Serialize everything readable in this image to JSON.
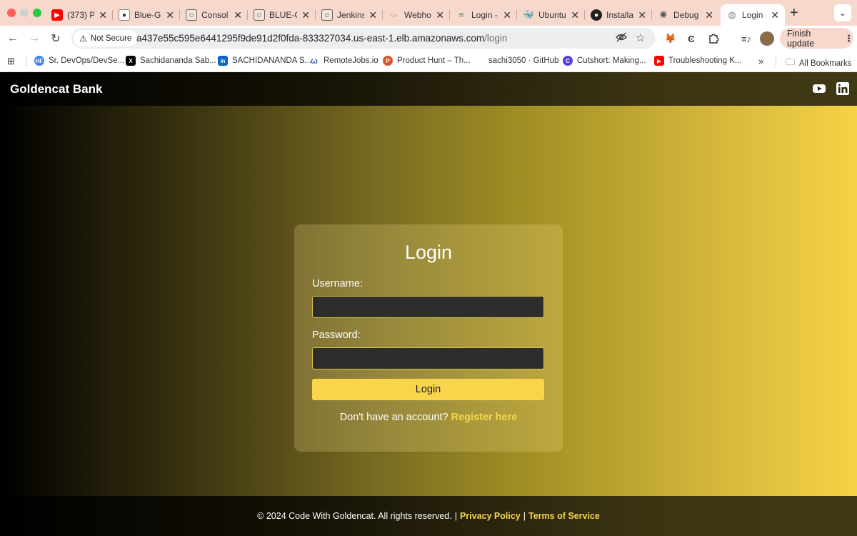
{
  "browser": {
    "tabs": [
      {
        "label": "(373) P",
        "icon": "youtube-icon",
        "color": "#ff0000"
      },
      {
        "label": "Blue-G",
        "icon": "github-icon",
        "color": "#333333"
      },
      {
        "label": "Consol",
        "icon": "jenkins-icon",
        "color": "#6b5b50"
      },
      {
        "label": "BLUE-G",
        "icon": "jenkins-icon",
        "color": "#6b5b50"
      },
      {
        "label": "Jenkins",
        "icon": "jenkins-icon",
        "color": "#6b5b50"
      },
      {
        "label": "Webho",
        "icon": "webhook-icon",
        "color": "#999999"
      },
      {
        "label": "Login -",
        "icon": "login-icon",
        "color": "#5a8c5a"
      },
      {
        "label": "Ubuntu",
        "icon": "docker-icon",
        "color": "#2496ed"
      },
      {
        "label": "Installa",
        "icon": "github-icon",
        "color": "#333333"
      },
      {
        "label": "Debug",
        "icon": "chatgpt-icon",
        "color": "#555555"
      },
      {
        "label": "Login -",
        "icon": "globe-icon",
        "color": "#888888",
        "active": true
      }
    ],
    "security_label": "Not Secure",
    "url_host": "a437e55c595e6441295f9de91d2f0fda-833327034.us-east-1.elb.amazonaws.com",
    "url_path": "/login",
    "finish_update_label": "Finish update",
    "bookmarks": [
      {
        "label": "Sr. DevOps/DevSe...",
        "icon": "hf-icon",
        "color": "#3b82f6"
      },
      {
        "label": "Sachidananda Sab...",
        "icon": "x-icon",
        "color": "#000000"
      },
      {
        "label": "SACHIDANANDA S...",
        "icon": "linkedin-icon",
        "color": "#0a66c2"
      },
      {
        "label": "RemoteJobs.io",
        "icon": "remotejobs-icon",
        "color": "#3a6fd8"
      },
      {
        "label": "Product Hunt – Th...",
        "icon": "producthunt-icon",
        "color": "#da552f"
      },
      {
        "label": "sachi3050 · GitHub",
        "icon": "github-icon",
        "color": "#ffffff"
      },
      {
        "label": "Cutshort: Making...",
        "icon": "cutshort-icon",
        "color": "#5b3fd6"
      },
      {
        "label": "Troubleshooting K...",
        "icon": "youtube-icon",
        "color": "#ff0000"
      }
    ],
    "all_bookmarks_label": "All Bookmarks"
  },
  "site": {
    "brand": "Goldencat Bank",
    "login": {
      "title": "Login",
      "username_label": "Username:",
      "password_label": "Password:",
      "username_value": "",
      "password_value": "",
      "button_label": "Login",
      "register_prompt": "Don't have an account?",
      "register_link": "Register here"
    },
    "footer": {
      "copyright": "© 2024 Code With Goldencat. All rights reserved.",
      "separator": "|",
      "privacy": "Privacy Policy",
      "terms": "Terms of Service"
    }
  }
}
